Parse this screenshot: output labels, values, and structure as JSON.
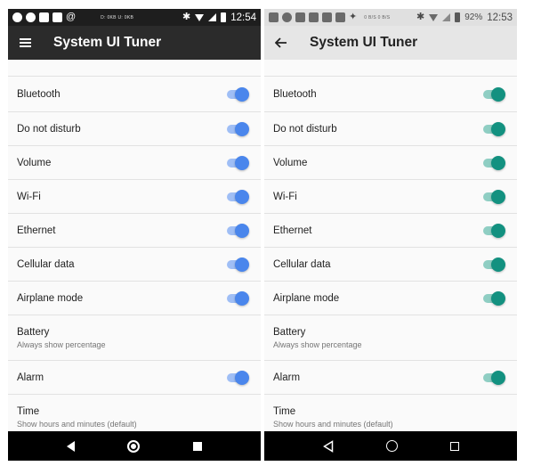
{
  "left": {
    "status": {
      "speed": "D: 0KB   U: 0KB",
      "time": "12:54"
    },
    "appbar": {
      "title": "System UI Tuner"
    },
    "colors": {
      "accent": "#4a86ec",
      "track": "#9fbef5"
    },
    "items": [
      {
        "title": "Bluetooth"
      },
      {
        "title": "Do not disturb"
      },
      {
        "title": "Volume"
      },
      {
        "title": "Wi-Fi"
      },
      {
        "title": "Ethernet"
      },
      {
        "title": "Cellular data"
      },
      {
        "title": "Airplane mode"
      },
      {
        "title": "Battery",
        "subtitle": "Always show percentage"
      },
      {
        "title": "Alarm"
      },
      {
        "title": "Time",
        "subtitle": "Show hours and minutes (default)"
      }
    ]
  },
  "right": {
    "status": {
      "speed": "0 B/S   0 B/S",
      "battery": "92%",
      "time": "12:53"
    },
    "appbar": {
      "title": "System UI Tuner"
    },
    "colors": {
      "accent": "#139180",
      "track": "#8fcec3"
    },
    "items": [
      {
        "title": "Bluetooth"
      },
      {
        "title": "Do not disturb"
      },
      {
        "title": "Volume"
      },
      {
        "title": "Wi-Fi"
      },
      {
        "title": "Ethernet"
      },
      {
        "title": "Cellular data"
      },
      {
        "title": "Airplane mode"
      },
      {
        "title": "Battery",
        "subtitle": "Always show percentage"
      },
      {
        "title": "Alarm"
      },
      {
        "title": "Time",
        "subtitle": "Show hours and minutes (default)"
      }
    ]
  },
  "toggles": {
    "bluetooth": true,
    "dnd": true,
    "volume": true,
    "wifi": true,
    "ethernet": true,
    "cellular": true,
    "airplane": true,
    "alarm": true
  },
  "icons": {
    "left_nav": "hamburger-icon",
    "right_nav": "arrow-back-icon"
  }
}
